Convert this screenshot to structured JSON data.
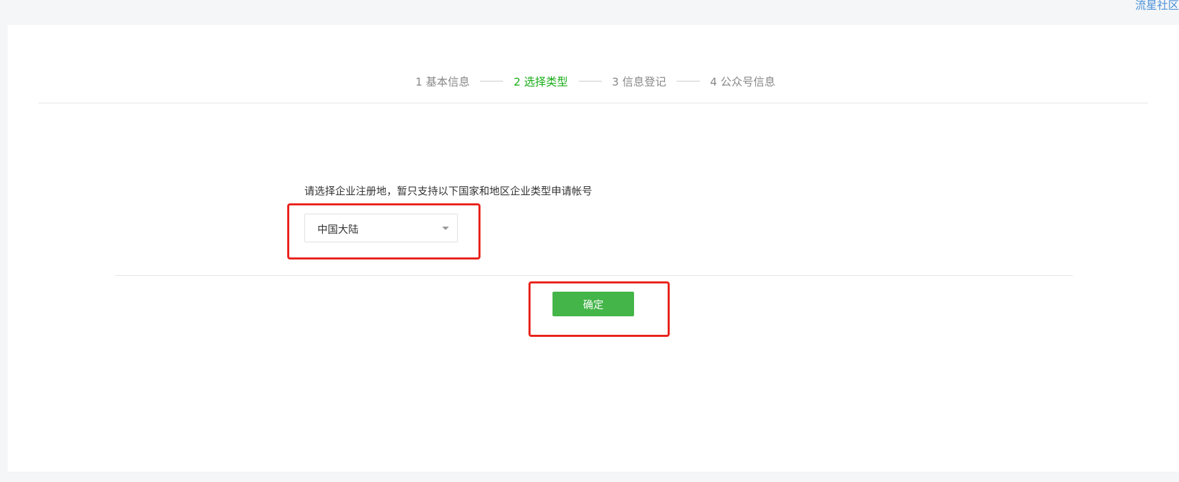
{
  "corner_link": "流星社区",
  "steps": [
    {
      "label": "1 基本信息",
      "active": false
    },
    {
      "label": "2 选择类型",
      "active": true
    },
    {
      "label": "3 信息登记",
      "active": false
    },
    {
      "label": "4 公众号信息",
      "active": false
    }
  ],
  "form": {
    "prompt": "请选择企业注册地，暂只支持以下国家和地区企业类型申请帐号",
    "region_select_value": "中国大陆",
    "confirm_label": "确定"
  },
  "colors": {
    "accent_green": "#1aad19",
    "button_green": "#44b549",
    "highlight_red": "#e8221b",
    "link_blue": "#4a90d9"
  },
  "icons": {
    "select_caret": "chevron-down-icon"
  }
}
